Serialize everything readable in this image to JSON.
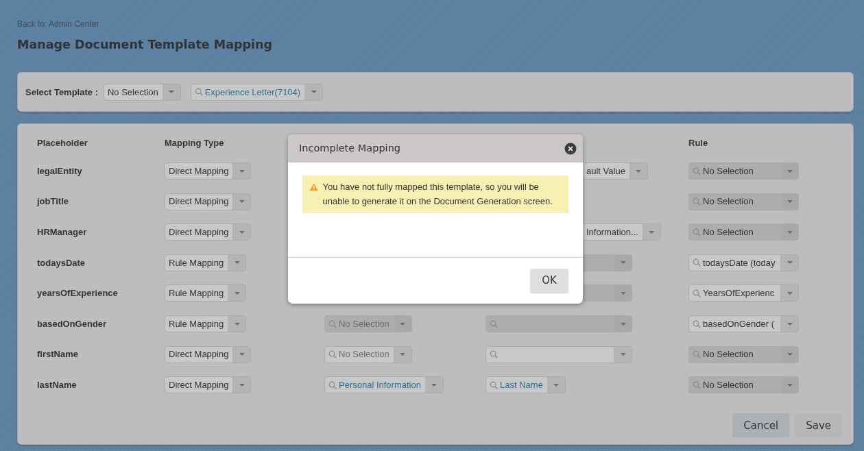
{
  "back_link": "Back to: Admin Center",
  "title": "Manage Document Template Mapping",
  "template_bar": {
    "label": "Select Template :",
    "type_select": {
      "value": "No Selection"
    },
    "template_select": {
      "value": "Experience Letter(7104)",
      "search": true,
      "link": true
    }
  },
  "table": {
    "columns": [
      "Placeholder",
      "Mapping Type",
      "Rule"
    ],
    "rows": [
      {
        "placeholder": "legalEntity",
        "mapping_type": {
          "value": "Direct Mapping"
        },
        "source": null,
        "field": {
          "value": "ault Value",
          "clipped": true
        },
        "rule": {
          "value": "No Selection",
          "search": true,
          "disabled": true
        }
      },
      {
        "placeholder": "jobTitle",
        "mapping_type": {
          "value": "Direct Mapping"
        },
        "source": null,
        "field": null,
        "rule": {
          "value": "No Selection",
          "search": true,
          "disabled": true
        }
      },
      {
        "placeholder": "HRManager",
        "mapping_type": {
          "value": "Direct Mapping"
        },
        "source": null,
        "field": {
          "value": "Information...",
          "clipped": true
        },
        "rule": {
          "value": "No Selection",
          "search": true,
          "disabled": true
        }
      },
      {
        "placeholder": "todaysDate",
        "mapping_type": {
          "value": "Rule Mapping"
        },
        "source": null,
        "field": {
          "clipped": true,
          "disabled": true
        },
        "rule": {
          "value": "todaysDate (today",
          "search": true,
          "disabled": false
        }
      },
      {
        "placeholder": "yearsOfExperience",
        "mapping_type": {
          "value": "Rule Mapping"
        },
        "source": null,
        "field": {
          "clipped": true,
          "disabled": true
        },
        "rule": {
          "value": "YearsOfExperienc",
          "search": true,
          "disabled": false
        }
      },
      {
        "placeholder": "basedOnGender",
        "mapping_type": {
          "value": "Rule Mapping"
        },
        "source": {
          "placeholder": "No Selection",
          "search": true,
          "disabled": true
        },
        "field": {
          "search": true,
          "disabled": true
        },
        "rule": {
          "value": "basedOnGender (",
          "search": true,
          "disabled": false
        }
      },
      {
        "placeholder": "firstName",
        "mapping_type": {
          "value": "Direct Mapping"
        },
        "source": {
          "placeholder": "No Selection",
          "search": true,
          "disabled": false
        },
        "field": {
          "search": true,
          "disabled": false
        },
        "rule": {
          "value": "No Selection",
          "search": true,
          "disabled": true
        }
      },
      {
        "placeholder": "lastName",
        "mapping_type": {
          "value": "Direct Mapping"
        },
        "source": {
          "value": "Personal Information",
          "search": true,
          "link": true
        },
        "field": {
          "value": "Last Name",
          "search": true,
          "link": true
        },
        "rule": {
          "value": "No Selection",
          "search": true,
          "disabled": true
        }
      }
    ]
  },
  "buttons": [
    {
      "label": "Cancel",
      "kind": "secondary"
    },
    {
      "label": "Save",
      "kind": "plain"
    }
  ],
  "dialog": {
    "title": "Incomplete Mapping",
    "message": "You have not fully mapped this template, so you will be unable to generate it on the Document Generation screen.",
    "button": "OK"
  }
}
